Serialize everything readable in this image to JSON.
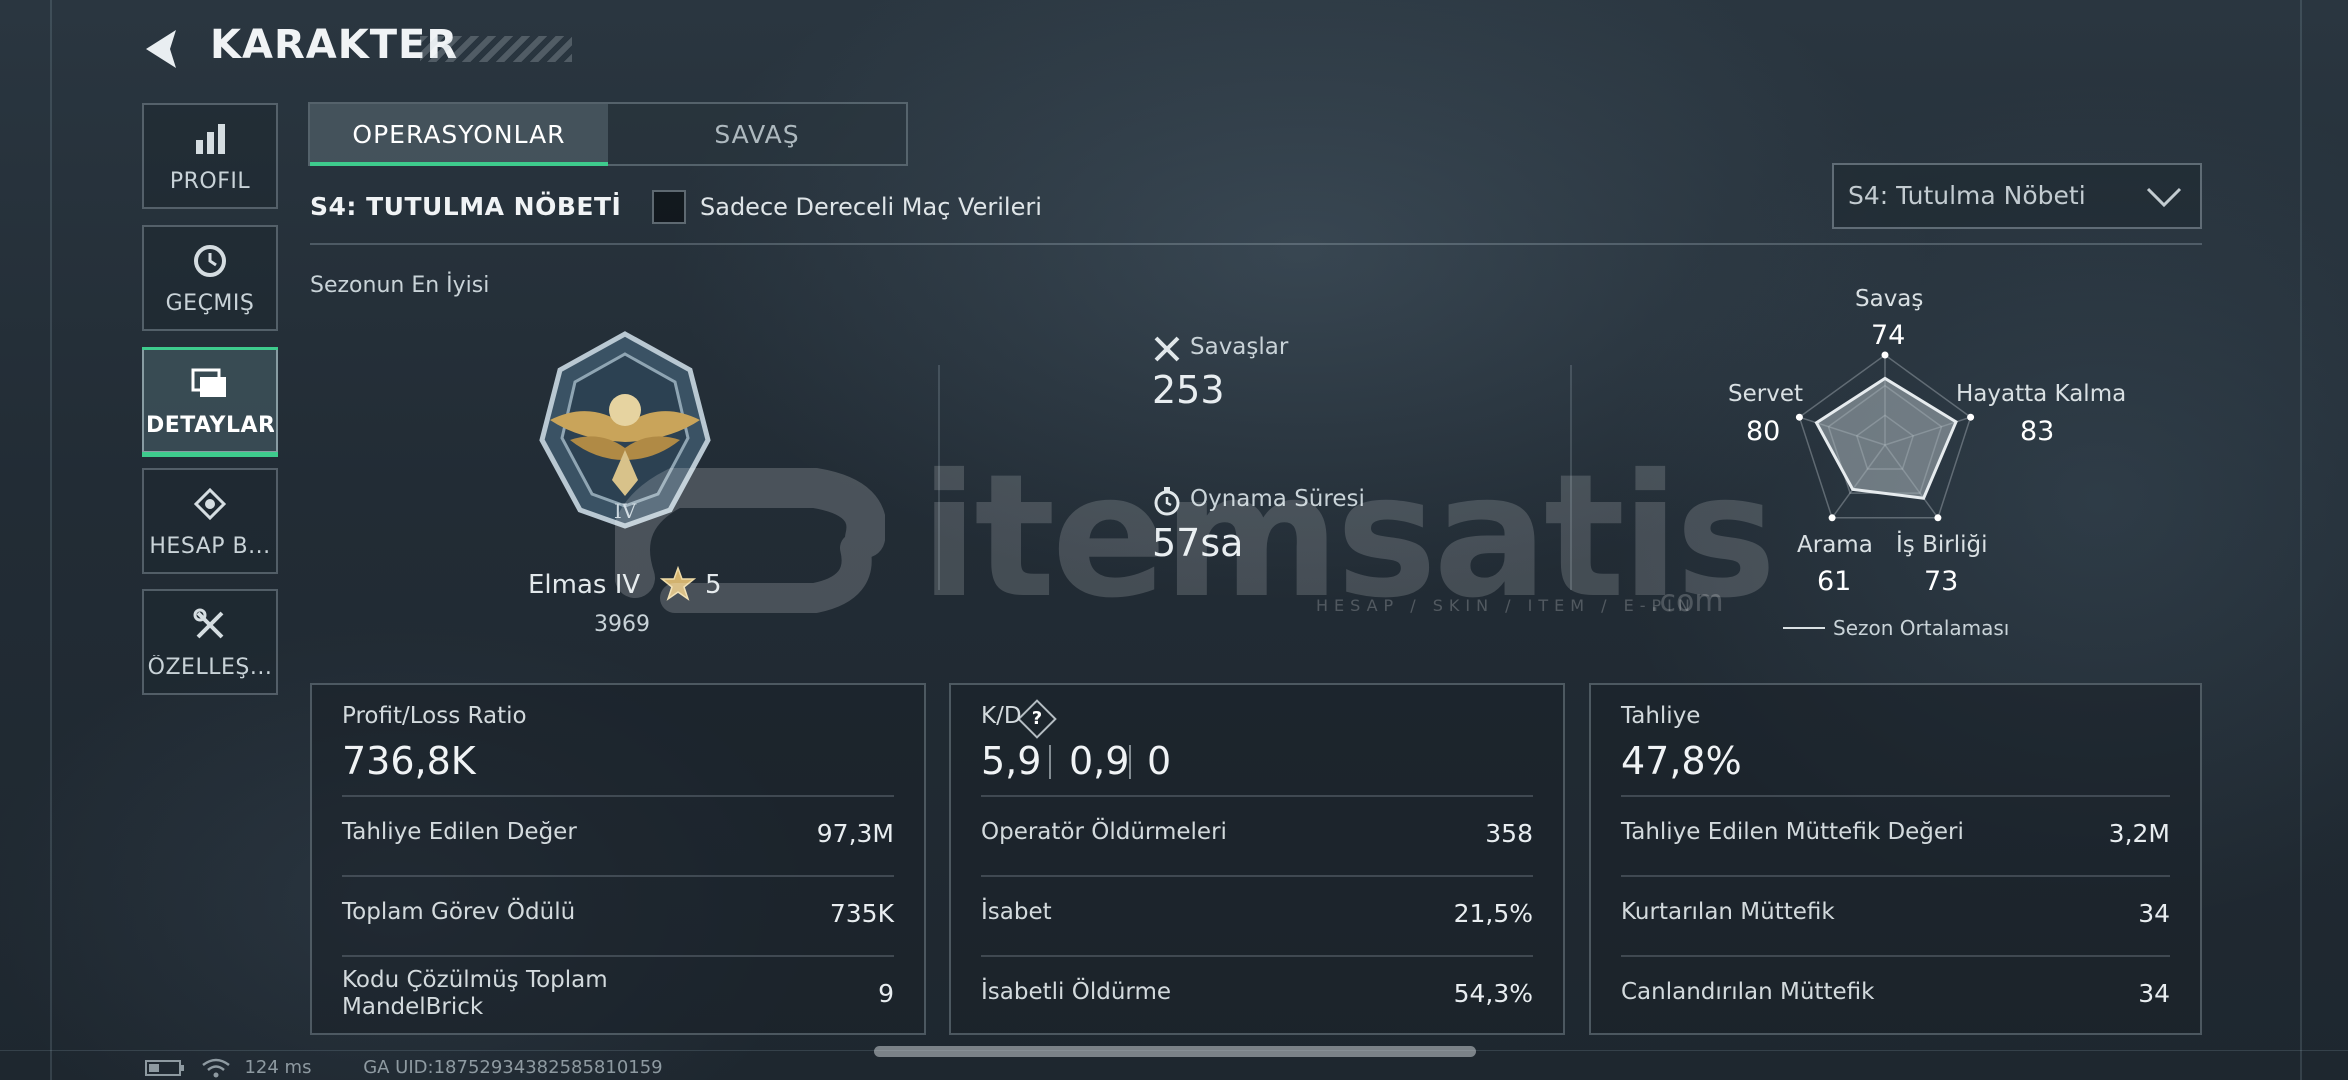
{
  "header": {
    "title": "KARAKTER",
    "back_icon": "back-arrow-icon"
  },
  "sidebar": {
    "items": [
      {
        "label": "PROFIL",
        "icon": "bar-chart-icon",
        "active": false
      },
      {
        "label": "GEÇMIŞ",
        "icon": "history-clock-icon",
        "active": false
      },
      {
        "label": "DETAYLAR",
        "icon": "cards-stack-icon",
        "active": true
      },
      {
        "label": "HESAP B...",
        "icon": "account-badge-icon",
        "active": false
      },
      {
        "label": "ÖZELLEŞ...",
        "icon": "wrench-tools-icon",
        "active": false
      }
    ]
  },
  "tabs": [
    {
      "label": "OPERASYONLAR",
      "active": true
    },
    {
      "label": "SAVAŞ",
      "active": false
    }
  ],
  "season": {
    "title": "S4: TUTULMA NÖBETİ",
    "ranked_only_label": "Sadece Dereceli Maç Verileri",
    "ranked_only_checked": false,
    "dropdown_value": "S4: Tutulma Nöbeti"
  },
  "best": {
    "label": "Sezonun En İyisi",
    "rank_name": "Elmas IV",
    "rank_stars": "5",
    "rank_points": "3969"
  },
  "stats": {
    "battles_label": "Savaşlar",
    "battles_value": "253",
    "playtime_label": "Oynama Süresi",
    "playtime_value": "57sa"
  },
  "radar": {
    "axes": [
      {
        "label": "Savaş",
        "value": "74"
      },
      {
        "label": "Hayatta Kalma",
        "value": "83"
      },
      {
        "label": "İş Birliği",
        "value": "73"
      },
      {
        "label": "Arama",
        "value": "61"
      },
      {
        "label": "Servet",
        "value": "80"
      }
    ],
    "legend": "Sezon Ortalaması"
  },
  "cards": {
    "profit": {
      "label": "Profit/Loss Ratio",
      "value": "736,8K",
      "rows": [
        {
          "k": "Tahliye Edilen Değer",
          "v": "97,3M"
        },
        {
          "k": "Toplam Görev Ödülü",
          "v": "735K"
        },
        {
          "k": "Kodu Çözülmüş Toplam MandelBrick",
          "v": "9"
        }
      ]
    },
    "kd": {
      "label": "K/D",
      "help": "?",
      "values": [
        "5,9",
        "0,9",
        "0"
      ],
      "rows": [
        {
          "k": "Operatör Öldürmeleri",
          "v": "358"
        },
        {
          "k": "İsabet",
          "v": "21,5%"
        },
        {
          "k": "İsabetli Öldürme",
          "v": "54,3%"
        }
      ]
    },
    "extract": {
      "label": "Tahliye",
      "value": "47,8%",
      "rows": [
        {
          "k": "Tahliye Edilen Müttefik Değeri",
          "v": "3,2M"
        },
        {
          "k": "Kurtarılan Müttefik",
          "v": "34"
        },
        {
          "k": "Canlandırılan Müttefik",
          "v": "34"
        }
      ]
    }
  },
  "status": {
    "ping": "124 ms",
    "uid": "GA UID:18752934382585810159"
  },
  "watermark": {
    "brand": "itemsatis",
    "tagline": "HESAP / SKIN / ITEM / E-PIN",
    "suffix": ".com"
  },
  "colors": {
    "accent": "#3ecb8d",
    "background": "#222c35"
  }
}
